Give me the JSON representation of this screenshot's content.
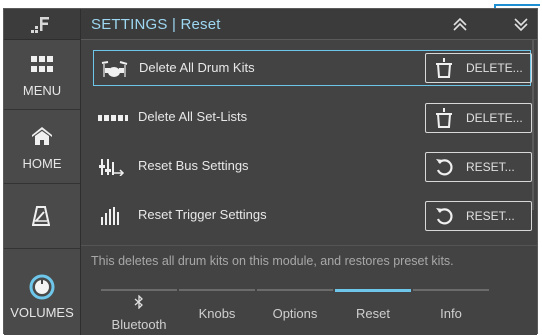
{
  "header": {
    "title": "SETTINGS | Reset"
  },
  "sidebar": {
    "items": [
      {
        "label": "MENU"
      },
      {
        "label": "HOME"
      },
      {
        "label": ""
      },
      {
        "label": "VOLUMES"
      }
    ]
  },
  "rows": [
    {
      "label": "Delete All Drum Kits",
      "button": "DELETE...",
      "icon": "drum-kit-icon"
    },
    {
      "label": "Delete All Set-Lists",
      "button": "DELETE...",
      "icon": "set-list-icon"
    },
    {
      "label": "Reset Bus Settings",
      "button": "RESET...",
      "icon": "bus-mixer-icon"
    },
    {
      "label": "Reset Trigger Settings",
      "button": "RESET...",
      "icon": "trigger-bars-icon"
    }
  ],
  "description": "This deletes all drum kits on this module, and restores preset kits.",
  "tabs": [
    {
      "label": "Bluetooth"
    },
    {
      "label": "Knobs"
    },
    {
      "label": "Options"
    },
    {
      "label": "Reset",
      "active": true
    },
    {
      "label": "Info"
    }
  ],
  "colors": {
    "accent": "#6ec6ea",
    "background": "#434343",
    "title": "#9dd7f2",
    "callout": "#1e8fd0"
  }
}
